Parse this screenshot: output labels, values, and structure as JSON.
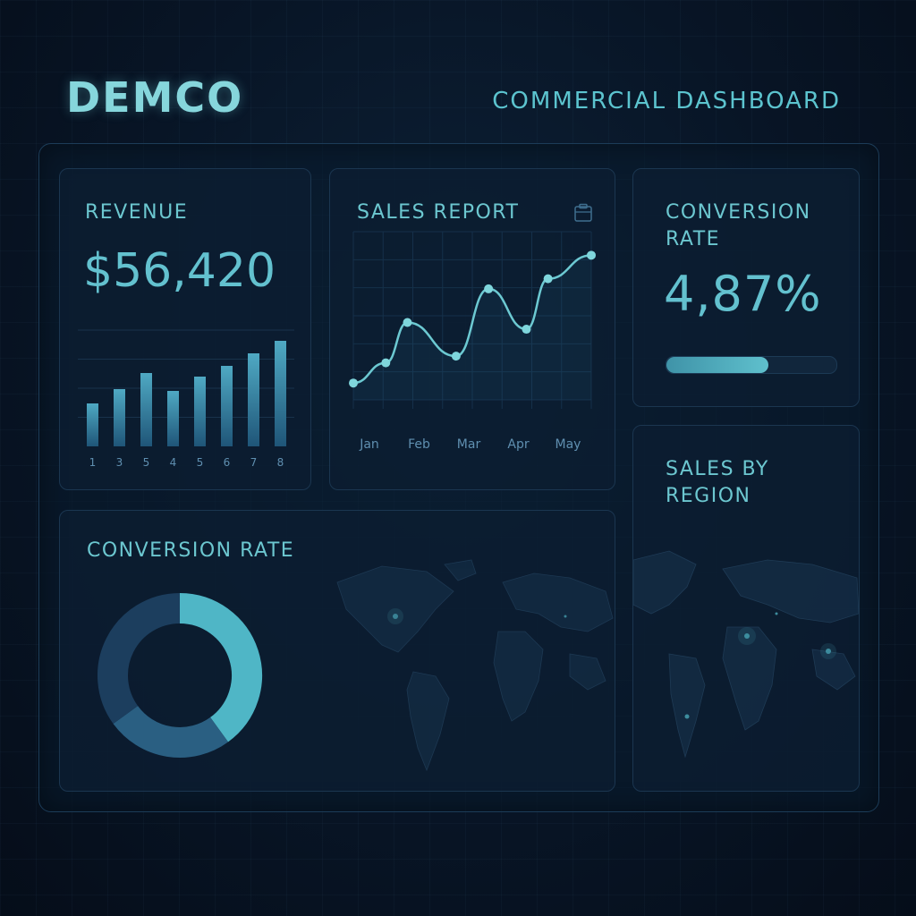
{
  "header": {
    "brand": "DEMCO",
    "title": "COMMERCIAL DASHBOARD"
  },
  "revenue": {
    "title": "REVENUE",
    "value": "$56,420"
  },
  "sales_report": {
    "title": "SALES REPORT",
    "icon": "clipboard-icon"
  },
  "conversion_top": {
    "title_line1": "CONVERSION",
    "title_line2": "RATE",
    "value": "4,87%",
    "progress": 0.6
  },
  "conversion_bottom": {
    "title": "CONVERSION RATE"
  },
  "sales_region": {
    "title_line1": "SALES BY",
    "title_line2": "REGION"
  },
  "colors": {
    "accent": "#6cc7d0",
    "bar": "#3a8fb0",
    "donut_light": "#4fb6c6",
    "donut_dark": "#1c3e5e"
  },
  "chart_data": [
    {
      "type": "bar",
      "categories": [
        "1",
        "3",
        "5",
        "4",
        "5",
        "6",
        "7",
        "8"
      ],
      "values": [
        48,
        64,
        82,
        62,
        78,
        90,
        104,
        118
      ],
      "ylim": [
        0,
        130
      ]
    },
    {
      "type": "line",
      "categories": [
        "Jan",
        "Feb",
        "Mar",
        "Apr",
        "May"
      ],
      "x": [
        0,
        0.6,
        1.0,
        1.9,
        2.5,
        3.2,
        3.6,
        4.4
      ],
      "values": [
        10,
        22,
        46,
        26,
        66,
        42,
        72,
        86
      ],
      "ylim": [
        0,
        100
      ]
    },
    {
      "type": "pie",
      "values": [
        40,
        25,
        35
      ]
    }
  ]
}
